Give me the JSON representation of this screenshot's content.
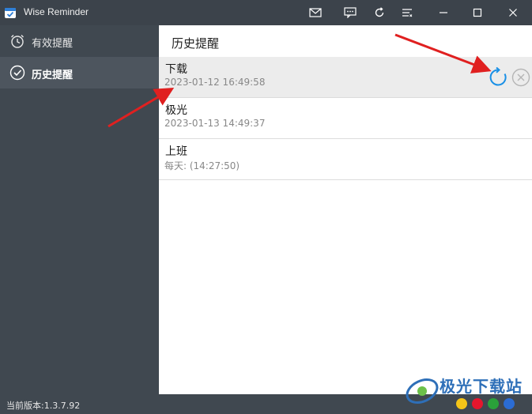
{
  "window": {
    "title": "Wise Reminder"
  },
  "titlebar": {
    "icons": [
      "mail-icon",
      "message-icon",
      "refresh-icon",
      "menu-icon",
      "minimize-icon",
      "maximize-icon",
      "close-icon"
    ]
  },
  "sidebar": {
    "items": [
      {
        "label": "有效提醒",
        "icon": "alarm-clock-icon",
        "active": false
      },
      {
        "label": "历史提醒",
        "icon": "check-circle-icon",
        "active": true
      }
    ]
  },
  "main": {
    "title": "历史提醒",
    "rows": [
      {
        "title": "下载",
        "time": "2023-01-12 16:49:58",
        "selected": true
      },
      {
        "title": "极光",
        "time": "2023-01-13 14:49:37",
        "selected": false
      },
      {
        "title": "上班",
        "time": "每天: (14:27:50)",
        "selected": false
      }
    ],
    "row_actions": [
      "restore-icon",
      "delete-icon"
    ]
  },
  "statusbar": {
    "version": "当前版本:1.3.7.92"
  },
  "watermark": {
    "text": "极光下载站"
  },
  "colors": {
    "sidebar_bg": "#404850",
    "titlebar_bg": "#3c434b",
    "accent_blue": "#1a90e6",
    "annotation_red": "#e02020",
    "selected_row": "#ececec"
  }
}
